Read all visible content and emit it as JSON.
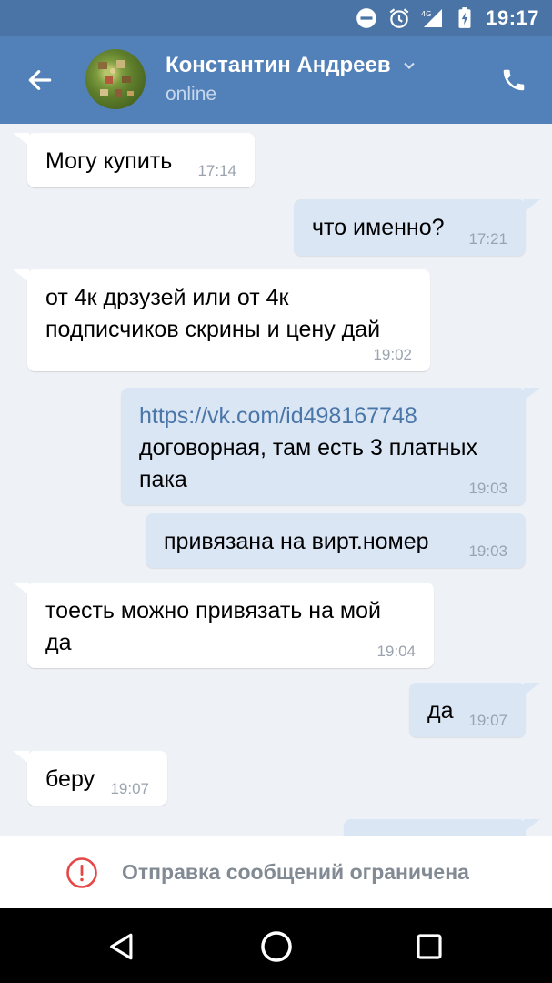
{
  "status_bar": {
    "time": "19:17",
    "network": "4G",
    "icons": [
      "dnd-icon",
      "alarm-icon",
      "signal-icon",
      "battery-charging-icon"
    ]
  },
  "header": {
    "contact_name": "Константин Андреев",
    "contact_status": "online",
    "icons": [
      "back-arrow-icon",
      "chevron-down-icon",
      "phone-icon"
    ]
  },
  "messages": [
    {
      "direction": "in",
      "text": [
        "Могу купить"
      ],
      "time": "17:14"
    },
    {
      "direction": "out",
      "text": [
        "что именно?"
      ],
      "time": "17:21"
    },
    {
      "direction": "in",
      "text": [
        "от 4к дрзузей или от 4к",
        "подписчиков скрины и цену дай"
      ],
      "time": "19:02"
    },
    {
      "direction": "out",
      "link": "https://vk.com/id498167748",
      "text": [
        "договорная, там есть 3 платных",
        "пака"
      ],
      "time": "19:03"
    },
    {
      "direction": "out",
      "text": [
        "привязана на вирт.номер"
      ],
      "time": "19:03"
    },
    {
      "direction": "in",
      "text": [
        "тоесть можно привязать на мой",
        "да"
      ],
      "time": "19:04"
    },
    {
      "direction": "out",
      "text": [
        "да"
      ],
      "time": "19:07"
    },
    {
      "direction": "in",
      "text": [
        "беру"
      ],
      "time": "19:07"
    }
  ],
  "footer": {
    "restriction_text": "Отправка сообщений ограничена",
    "icon": "warning-circle-icon",
    "accent_color": "#e64646"
  },
  "nav_bar": {
    "icons": [
      "nav-back-icon",
      "nav-home-icon",
      "nav-recents-icon"
    ]
  },
  "colors": {
    "header_bg": "#5181b8",
    "status_bar_bg": "#4a73a6",
    "chat_bg": "#eef1f5",
    "incoming_bubble": "#ffffff",
    "outgoing_bubble": "#dbe6f5",
    "link": "#4a76a8"
  }
}
